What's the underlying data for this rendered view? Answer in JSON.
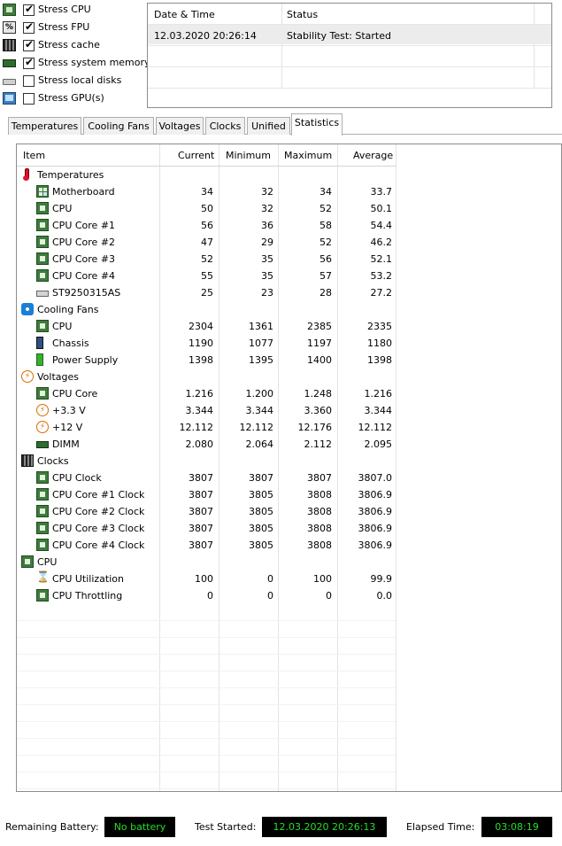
{
  "stress_options": [
    {
      "label": "Stress CPU",
      "checked": true,
      "icon": "cpu-chip-icon"
    },
    {
      "label": "Stress FPU",
      "checked": true,
      "icon": "fpu-icon"
    },
    {
      "label": "Stress cache",
      "checked": true,
      "icon": "cache-icon"
    },
    {
      "label": "Stress system memory",
      "checked": true,
      "icon": "memory-icon"
    },
    {
      "label": "Stress local disks",
      "checked": false,
      "icon": "disk-icon"
    },
    {
      "label": "Stress GPU(s)",
      "checked": false,
      "icon": "gpu-icon"
    }
  ],
  "status_log": {
    "headers": {
      "datetime": "Date & Time",
      "status": "Status"
    },
    "rows": [
      {
        "datetime": "12.03.2020 20:26:14",
        "status": "Stability Test: Started"
      }
    ]
  },
  "tabs": [
    {
      "label": "Temperatures",
      "active": false
    },
    {
      "label": "Cooling Fans",
      "active": false
    },
    {
      "label": "Voltages",
      "active": false
    },
    {
      "label": "Clocks",
      "active": false
    },
    {
      "label": "Unified",
      "active": false
    },
    {
      "label": "Statistics",
      "active": true
    }
  ],
  "table": {
    "headers": {
      "item": "Item",
      "current": "Current",
      "minimum": "Minimum",
      "maximum": "Maximum",
      "average": "Average"
    },
    "groups": [
      {
        "label": "Temperatures",
        "icon": "thermometer-icon",
        "rows": [
          {
            "name": "Motherboard",
            "icon": "motherboard-icon",
            "current": "34",
            "min": "32",
            "max": "34",
            "avg": "33.7"
          },
          {
            "name": "CPU",
            "icon": "cpu-chip-icon",
            "current": "50",
            "min": "32",
            "max": "52",
            "avg": "50.1"
          },
          {
            "name": "CPU Core #1",
            "icon": "cpu-chip-icon",
            "current": "56",
            "min": "36",
            "max": "58",
            "avg": "54.4"
          },
          {
            "name": "CPU Core #2",
            "icon": "cpu-chip-icon",
            "current": "47",
            "min": "29",
            "max": "52",
            "avg": "46.2"
          },
          {
            "name": "CPU Core #3",
            "icon": "cpu-chip-icon",
            "current": "52",
            "min": "35",
            "max": "56",
            "avg": "52.1"
          },
          {
            "name": "CPU Core #4",
            "icon": "cpu-chip-icon",
            "current": "55",
            "min": "35",
            "max": "57",
            "avg": "53.2"
          },
          {
            "name": "ST9250315AS",
            "icon": "hard-drive-icon",
            "current": "25",
            "min": "23",
            "max": "28",
            "avg": "27.2"
          }
        ]
      },
      {
        "label": "Cooling Fans",
        "icon": "fan-icon",
        "rows": [
          {
            "name": "CPU",
            "icon": "cpu-chip-icon",
            "current": "2304",
            "min": "1361",
            "max": "2385",
            "avg": "2335"
          },
          {
            "name": "Chassis",
            "icon": "chassis-icon",
            "current": "1190",
            "min": "1077",
            "max": "1197",
            "avg": "1180"
          },
          {
            "name": "Power Supply",
            "icon": "power-supply-icon",
            "current": "1398",
            "min": "1395",
            "max": "1400",
            "avg": "1398"
          }
        ]
      },
      {
        "label": "Voltages",
        "icon": "voltage-icon",
        "rows": [
          {
            "name": "CPU Core",
            "icon": "cpu-chip-icon",
            "current": "1.216",
            "min": "1.200",
            "max": "1.248",
            "avg": "1.216"
          },
          {
            "name": "+3.3 V",
            "icon": "voltage-icon",
            "current": "3.344",
            "min": "3.344",
            "max": "3.360",
            "avg": "3.344"
          },
          {
            "name": "+12 V",
            "icon": "voltage-icon",
            "current": "12.112",
            "min": "12.112",
            "max": "12.176",
            "avg": "12.112"
          },
          {
            "name": "DIMM",
            "icon": "memory-icon",
            "current": "2.080",
            "min": "2.064",
            "max": "2.112",
            "avg": "2.095"
          }
        ]
      },
      {
        "label": "Clocks",
        "icon": "clock-icon",
        "rows": [
          {
            "name": "CPU Clock",
            "icon": "cpu-chip-icon",
            "current": "3807",
            "min": "3807",
            "max": "3807",
            "avg": "3807.0"
          },
          {
            "name": "CPU Core #1 Clock",
            "icon": "cpu-chip-icon",
            "current": "3807",
            "min": "3805",
            "max": "3808",
            "avg": "3806.9"
          },
          {
            "name": "CPU Core #2 Clock",
            "icon": "cpu-chip-icon",
            "current": "3807",
            "min": "3805",
            "max": "3808",
            "avg": "3806.9"
          },
          {
            "name": "CPU Core #3 Clock",
            "icon": "cpu-chip-icon",
            "current": "3807",
            "min": "3805",
            "max": "3808",
            "avg": "3806.9"
          },
          {
            "name": "CPU Core #4 Clock",
            "icon": "cpu-chip-icon",
            "current": "3807",
            "min": "3805",
            "max": "3808",
            "avg": "3806.9"
          }
        ]
      },
      {
        "label": "CPU",
        "icon": "cpu-chip-icon",
        "rows": [
          {
            "name": "CPU Utilization",
            "icon": "hourglass-icon",
            "current": "100",
            "min": "0",
            "max": "100",
            "avg": "99.9"
          },
          {
            "name": "CPU Throttling",
            "icon": "cpu-chip-icon",
            "current": "0",
            "min": "0",
            "max": "0",
            "avg": "0.0"
          }
        ]
      }
    ]
  },
  "status_bar": {
    "battery_label": "Remaining Battery:",
    "battery_value": "No battery",
    "started_label": "Test Started:",
    "started_value": "12.03.2020 20:26:13",
    "elapsed_label": "Elapsed Time:",
    "elapsed_value": "03:08:19"
  },
  "colors": {
    "status_box_bg": "#000000",
    "status_box_text": "#22e022"
  }
}
